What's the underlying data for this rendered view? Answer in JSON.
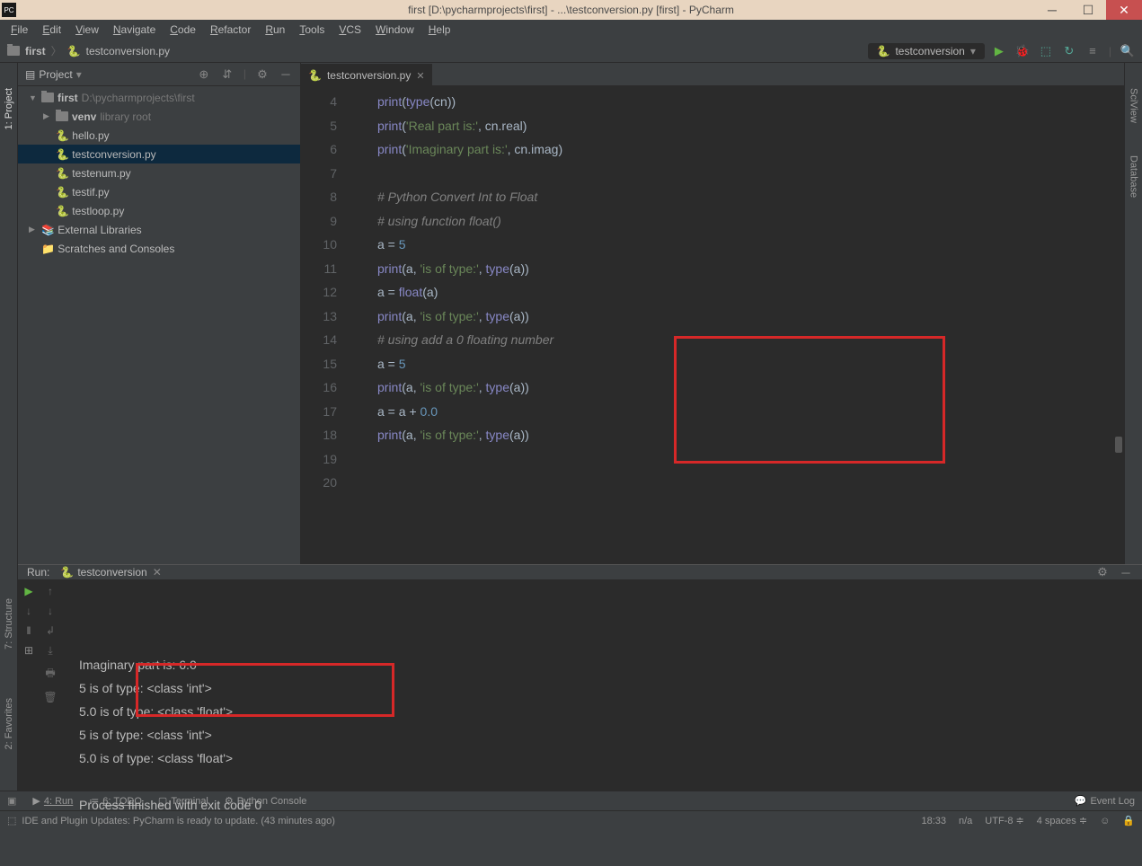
{
  "titlebar": {
    "text": "first [D:\\pycharmprojects\\first] - ...\\testconversion.py [first] - PyCharm",
    "logo": "PC"
  },
  "menu": [
    "File",
    "Edit",
    "View",
    "Navigate",
    "Code",
    "Refactor",
    "Run",
    "Tools",
    "VCS",
    "Window",
    "Help"
  ],
  "breadcrumb": {
    "folder": "first",
    "file": "testconversion.py"
  },
  "run_config": {
    "label": "testconversion"
  },
  "project_panel": {
    "title": "Project",
    "root": {
      "name": "first",
      "path": "D:\\pycharmprojects\\first"
    },
    "venv": "venv",
    "venv_suffix": "library root",
    "files": [
      "hello.py",
      "testconversion.py",
      "testenum.py",
      "testif.py",
      "testloop.py"
    ],
    "selected_file": "testconversion.py",
    "external": "External Libraries",
    "scratches": "Scratches and Consoles"
  },
  "sidebar_tabs": {
    "project": "1: Project"
  },
  "right_tabs": {
    "sciview": "SciView",
    "database": "Database"
  },
  "editor": {
    "tab": "testconversion.py",
    "lines": [
      {
        "n": 4,
        "tokens": [
          [
            "fn",
            "print"
          ],
          [
            "paren",
            "("
          ],
          [
            "builtin",
            "type"
          ],
          [
            "paren",
            "("
          ],
          [
            "ident",
            "cn"
          ],
          [
            "paren",
            "))"
          ]
        ]
      },
      {
        "n": 5,
        "tokens": [
          [
            "fn",
            "print"
          ],
          [
            "paren",
            "("
          ],
          [
            "str",
            "'Real part is:'"
          ],
          [
            "op",
            ", "
          ],
          [
            "ident",
            "cn"
          ],
          [
            "op",
            "."
          ],
          [
            "ident",
            "real"
          ],
          [
            "paren",
            ")"
          ]
        ]
      },
      {
        "n": 6,
        "tokens": [
          [
            "fn",
            "print"
          ],
          [
            "paren",
            "("
          ],
          [
            "str",
            "'Imaginary part is:'"
          ],
          [
            "op",
            ", "
          ],
          [
            "ident",
            "cn"
          ],
          [
            "op",
            "."
          ],
          [
            "ident",
            "imag"
          ],
          [
            "paren",
            ")"
          ]
        ]
      },
      {
        "n": 7,
        "tokens": []
      },
      {
        "n": 8,
        "tokens": [
          [
            "comment",
            "# Python Convert Int to Float"
          ]
        ]
      },
      {
        "n": 9,
        "tokens": [
          [
            "comment",
            "# using function float()"
          ]
        ]
      },
      {
        "n": 10,
        "tokens": [
          [
            "ident",
            "a"
          ],
          [
            "op",
            " = "
          ],
          [
            "num",
            "5"
          ]
        ]
      },
      {
        "n": 11,
        "tokens": [
          [
            "fn",
            "print"
          ],
          [
            "paren",
            "("
          ],
          [
            "ident",
            "a"
          ],
          [
            "op",
            ", "
          ],
          [
            "str",
            "'is of type:'"
          ],
          [
            "op",
            ", "
          ],
          [
            "builtin",
            "type"
          ],
          [
            "paren",
            "("
          ],
          [
            "ident",
            "a"
          ],
          [
            "paren",
            "))"
          ]
        ]
      },
      {
        "n": 12,
        "tokens": [
          [
            "ident",
            "a"
          ],
          [
            "op",
            " = "
          ],
          [
            "builtin",
            "float"
          ],
          [
            "paren",
            "("
          ],
          [
            "ident",
            "a"
          ],
          [
            "paren",
            ")"
          ]
        ]
      },
      {
        "n": 13,
        "tokens": [
          [
            "fn",
            "print"
          ],
          [
            "paren",
            "("
          ],
          [
            "ident",
            "a"
          ],
          [
            "op",
            ", "
          ],
          [
            "str",
            "'is of type:'"
          ],
          [
            "op",
            ", "
          ],
          [
            "builtin",
            "type"
          ],
          [
            "paren",
            "("
          ],
          [
            "ident",
            "a"
          ],
          [
            "paren",
            "))"
          ]
        ]
      },
      {
        "n": 14,
        "tokens": [
          [
            "comment",
            "# using add a 0 floating number"
          ]
        ]
      },
      {
        "n": 15,
        "tokens": [
          [
            "ident",
            "a"
          ],
          [
            "op",
            " = "
          ],
          [
            "num",
            "5"
          ]
        ]
      },
      {
        "n": 16,
        "tokens": [
          [
            "fn",
            "print"
          ],
          [
            "paren",
            "("
          ],
          [
            "ident",
            "a"
          ],
          [
            "op",
            ", "
          ],
          [
            "str",
            "'is of type:'"
          ],
          [
            "op",
            ", "
          ],
          [
            "builtin",
            "type"
          ],
          [
            "paren",
            "("
          ],
          [
            "ident",
            "a"
          ],
          [
            "paren",
            "))"
          ]
        ]
      },
      {
        "n": 17,
        "tokens": [
          [
            "ident",
            "a"
          ],
          [
            "op",
            " = "
          ],
          [
            "ident",
            "a"
          ],
          [
            "op",
            " + "
          ],
          [
            "num",
            "0.0"
          ]
        ]
      },
      {
        "n": 18,
        "tokens": [
          [
            "fn",
            "print"
          ],
          [
            "paren",
            "("
          ],
          [
            "ident",
            "a"
          ],
          [
            "op",
            ", "
          ],
          [
            "str",
            "'is of type:'"
          ],
          [
            "op",
            ", "
          ],
          [
            "builtin",
            "type"
          ],
          [
            "paren",
            "("
          ],
          [
            "ident",
            "a"
          ],
          [
            "paren",
            "))"
          ]
        ]
      },
      {
        "n": 19,
        "tokens": []
      },
      {
        "n": 20,
        "tokens": []
      }
    ]
  },
  "run_panel": {
    "label": "Run:",
    "tab": "testconversion",
    "output": [
      "Imaginary part is: 6.0",
      "5 is of type: <class 'int'>",
      "5.0 is of type: <class 'float'>",
      "5 is of type: <class 'int'>",
      "5.0 is of type: <class 'float'>",
      "",
      "Process finished with exit code 0"
    ]
  },
  "bottom": {
    "run": "4: Run",
    "todo": "6: TODO",
    "terminal": "Terminal",
    "console": "Python Console",
    "eventlog": "Event Log"
  },
  "status": {
    "msg": "IDE and Plugin Updates: PyCharm is ready to update. (43 minutes ago)",
    "pos": "18:33",
    "na": "n/a",
    "enc": "UTF-8",
    "indent": "4 spaces"
  },
  "left_lower_tabs": {
    "structure": "7: Structure",
    "fav": "2: Favorites"
  }
}
